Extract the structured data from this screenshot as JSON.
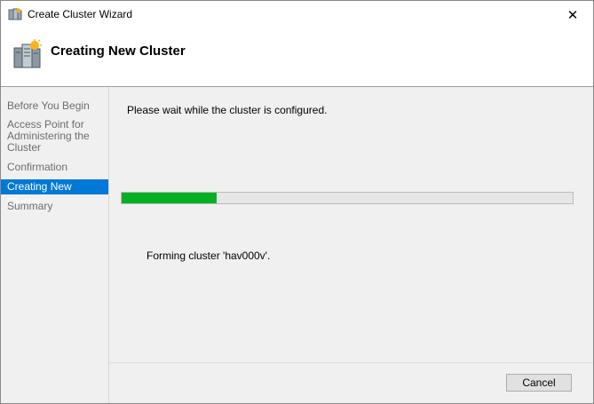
{
  "window": {
    "title": "Create Cluster Wizard",
    "close_glyph": "✕",
    "title_icon": "cluster-icon"
  },
  "header": {
    "title": "Creating New Cluster",
    "icon": "cluster-servers-icon"
  },
  "sidebar": {
    "steps": [
      {
        "label": "Before You Begin",
        "active": false
      },
      {
        "label": "Access Point for Administering the Cluster",
        "active": false
      },
      {
        "label": "Confirmation",
        "active": false
      },
      {
        "label": "Creating New Cluster",
        "active": true
      },
      {
        "label": "Summary",
        "active": false
      }
    ]
  },
  "main": {
    "message": "Please wait while the cluster is configured.",
    "progress_fraction": 0.21,
    "progress_color": "#06b025",
    "status": "Forming cluster 'hav000v'."
  },
  "footer": {
    "cancel_label": "Cancel"
  },
  "colors": {
    "accent": "#0078d7"
  }
}
